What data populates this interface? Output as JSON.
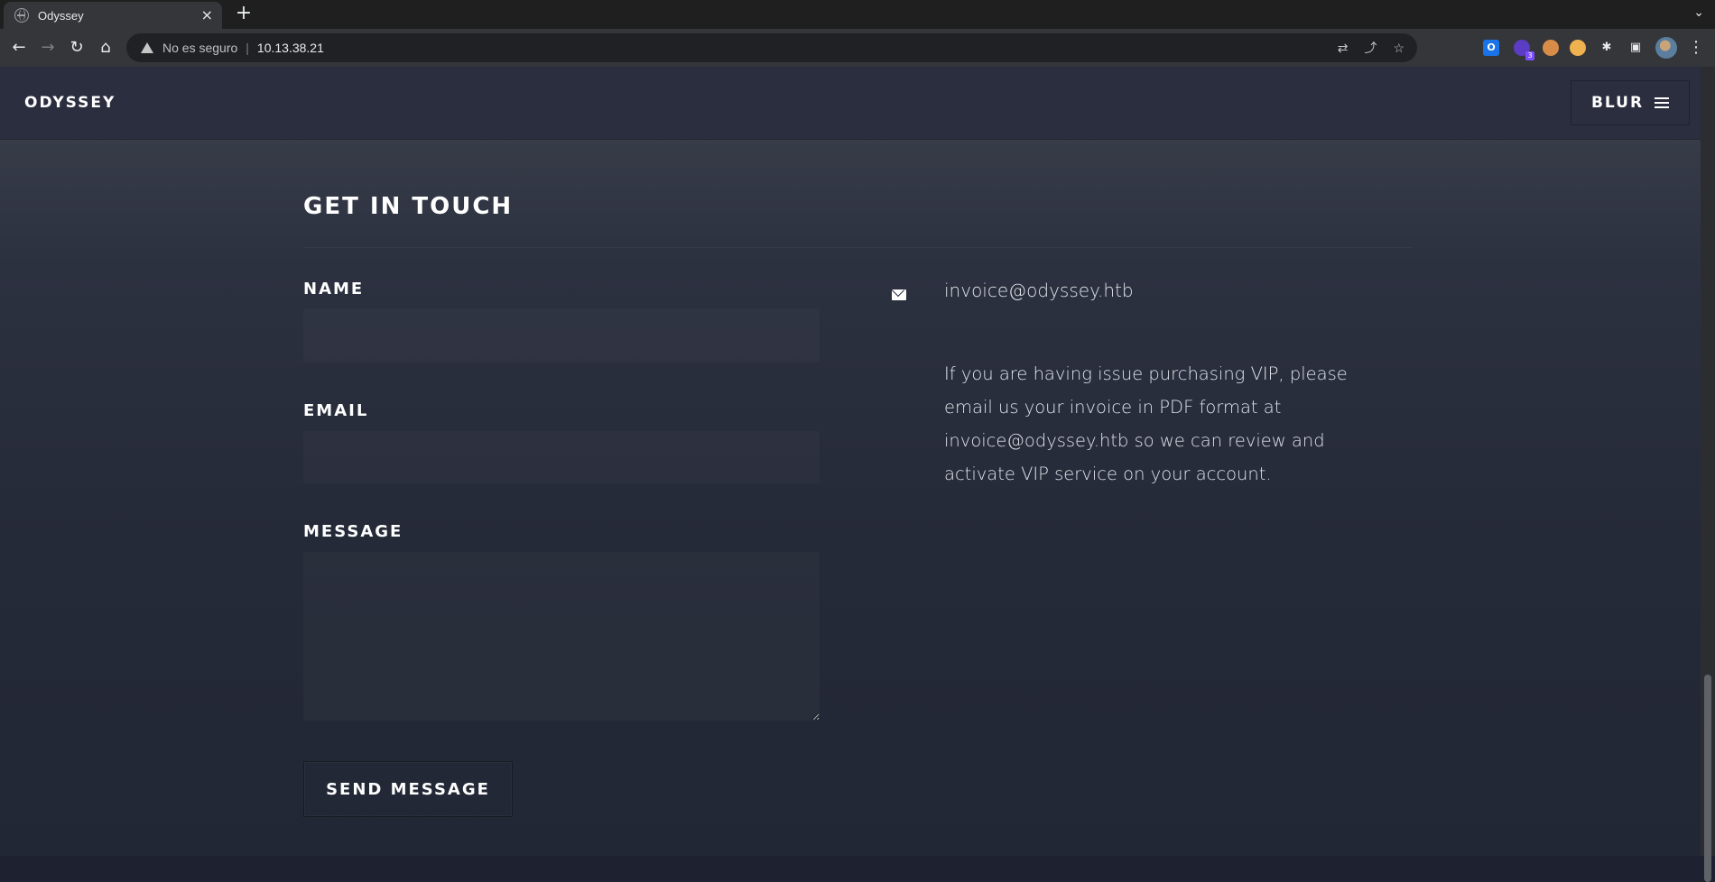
{
  "browser": {
    "tab": {
      "title": "Odyssey",
      "close_glyph": "×",
      "favicon": "globe-icon"
    },
    "new_tab_glyph": "+",
    "tab_menu_glyph": "⌄",
    "nav": {
      "back": "←",
      "forward": "→",
      "reload": "↻",
      "home": "⌂"
    },
    "omnibox": {
      "security_label": "No es seguro",
      "separator": "|",
      "url": "10.13.38.21",
      "icons": [
        "translate-icon",
        "share-icon",
        "star-icon"
      ]
    },
    "extensions": [
      {
        "name": "outlook-extension-icon",
        "glyph": "O"
      },
      {
        "name": "purple-extension-icon",
        "glyph": "",
        "badge": "3"
      },
      {
        "name": "cookie-extension-icon",
        "glyph": ""
      },
      {
        "name": "cookie-editor-extension-icon",
        "glyph": ""
      },
      {
        "name": "puzzle-extensions-icon",
        "glyph": "✱"
      },
      {
        "name": "side-panel-icon",
        "glyph": "▣"
      }
    ],
    "menu_glyph": "⋮"
  },
  "header": {
    "logo": "ODYSSEY",
    "menu_label": "BLUR"
  },
  "contact": {
    "title": "GET IN TOUCH",
    "form": {
      "name_label": "NAME",
      "email_label": "EMAIL",
      "message_label": "MESSAGE",
      "name_value": "",
      "email_value": "",
      "message_value": "",
      "submit_label": "SEND MESSAGE"
    },
    "info": {
      "email": "invoice@odyssey.htb",
      "note": "If you are having issue purchasing VIP, please email us your invoice in PDF format at invoice@odyssey.htb so we can review and activate VIP service on your account."
    }
  },
  "colors": {
    "header_bg": "#2a2e3e",
    "page_bg_top": "#3e424d",
    "page_bg_bottom": "#222735",
    "text": "#ffffff"
  }
}
